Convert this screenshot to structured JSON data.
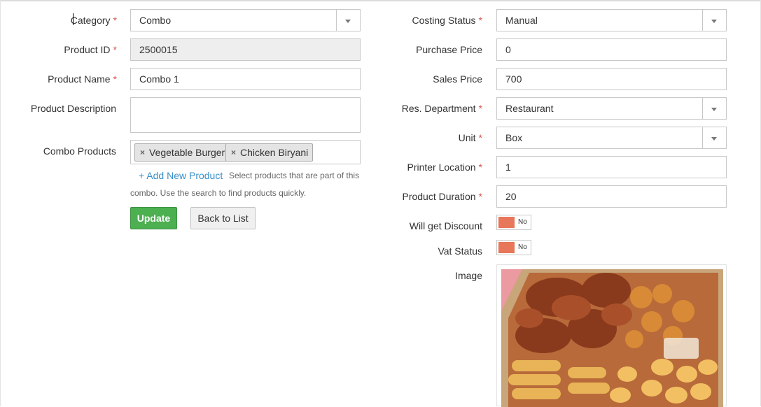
{
  "form": {
    "left": {
      "category": {
        "label": "Category",
        "value": "Combo"
      },
      "product_id": {
        "label": "Product ID",
        "value": "2500015"
      },
      "product_name": {
        "label": "Product Name",
        "value": "Combo 1"
      },
      "product_description": {
        "label": "Product Description",
        "value": ""
      },
      "combo_products": {
        "label": "Combo Products",
        "tags": [
          "Vegetable Burger",
          "Chicken Biryani"
        ],
        "remove_glyph": "×",
        "add_link": "+ Add New Product",
        "hint_line1": "Select products that are part of this",
        "hint_line2": "combo. Use the search to find products quickly."
      },
      "update_button": "Update",
      "back_button": "Back to List"
    },
    "right": {
      "costing_status": {
        "label": "Costing Status",
        "value": "Manual"
      },
      "purchase_price": {
        "label": "Purchase Price",
        "value": "0"
      },
      "sales_price": {
        "label": "Sales Price",
        "value": "700"
      },
      "res_department": {
        "label": "Res. Department",
        "value": "Restaurant"
      },
      "unit": {
        "label": "Unit",
        "value": "Box"
      },
      "printer_location": {
        "label": "Printer Location",
        "value": "1"
      },
      "product_duration": {
        "label": "Product Duration",
        "value": "20"
      },
      "will_get_discount": {
        "label": "Will get Discount",
        "value": "No"
      },
      "vat_status": {
        "label": "Vat Status",
        "value": "No"
      },
      "image": {
        "label": "Image"
      }
    },
    "required_mark": "*"
  },
  "colors": {
    "required": "#d9534f",
    "update_button": "#4caf50",
    "toggle_off": "#e8765a",
    "link": "#3a8fc9"
  }
}
